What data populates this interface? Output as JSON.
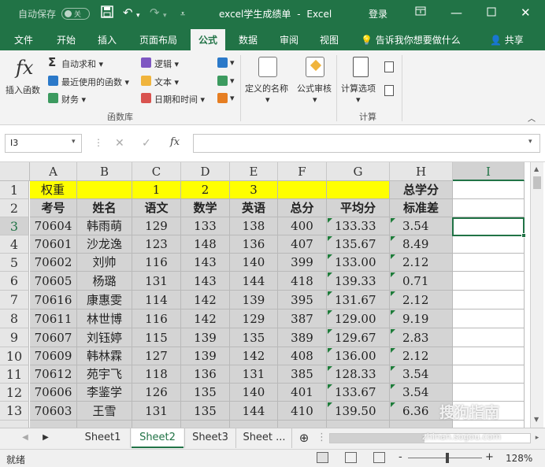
{
  "titlebar": {
    "autosave_label": "自动保存",
    "autosave_state": "关",
    "filename": "excel学生成绩单",
    "sep": "-",
    "app": "Excel",
    "login": "登录"
  },
  "tabs": [
    "文件",
    "开始",
    "插入",
    "页面布局",
    "公式",
    "数据",
    "审阅",
    "视图"
  ],
  "active_tab": "公式",
  "tell_me": "告诉我你想要做什么",
  "share": "共享",
  "ribbon": {
    "insert_function": "插入函数",
    "fx_glyph": "fx",
    "autosum": "自动求和",
    "recent": "最近使用的函数",
    "financial": "财务",
    "logical": "逻辑",
    "text": "文本",
    "datetime": "日期和时间",
    "group_library": "函数库",
    "defined_names": "定义的名称",
    "formula_audit": "公式审核",
    "calc_options": "计算选项",
    "group_calc": "计算"
  },
  "formula_bar": {
    "name_box": "I3",
    "fx": "fx",
    "value": ""
  },
  "columns": [
    "A",
    "B",
    "C",
    "D",
    "E",
    "F",
    "G",
    "H",
    "I"
  ],
  "selected_column": "I",
  "selected_row": "3",
  "rows": [
    {
      "n": "1",
      "cells": [
        "权重",
        "",
        "1",
        "2",
        "3",
        "",
        "",
        "总学分",
        ""
      ]
    },
    {
      "n": "2",
      "cells": [
        "考号",
        "姓名",
        "语文",
        "数学",
        "英语",
        "总分",
        "平均分",
        "标准差",
        ""
      ]
    },
    {
      "n": "3",
      "cells": [
        "70604",
        "韩雨萌",
        "129",
        "133",
        "138",
        "400",
        "133.33",
        "3.54",
        ""
      ]
    },
    {
      "n": "4",
      "cells": [
        "70601",
        "沙龙逸",
        "123",
        "148",
        "136",
        "407",
        "135.67",
        "8.49",
        ""
      ]
    },
    {
      "n": "5",
      "cells": [
        "70602",
        "刘帅",
        "116",
        "143",
        "140",
        "399",
        "133.00",
        "2.12",
        ""
      ]
    },
    {
      "n": "6",
      "cells": [
        "70605",
        "杨璐",
        "131",
        "143",
        "144",
        "418",
        "139.33",
        "0.71",
        ""
      ]
    },
    {
      "n": "7",
      "cells": [
        "70616",
        "康惠雯",
        "114",
        "142",
        "139",
        "395",
        "131.67",
        "2.12",
        ""
      ]
    },
    {
      "n": "8",
      "cells": [
        "70611",
        "林世博",
        "116",
        "142",
        "129",
        "387",
        "129.00",
        "9.19",
        ""
      ]
    },
    {
      "n": "9",
      "cells": [
        "70607",
        "刘钰婷",
        "115",
        "139",
        "135",
        "389",
        "129.67",
        "2.83",
        ""
      ]
    },
    {
      "n": "10",
      "cells": [
        "70609",
        "韩林霖",
        "127",
        "139",
        "142",
        "408",
        "136.00",
        "2.12",
        ""
      ]
    },
    {
      "n": "11",
      "cells": [
        "70612",
        "苑宇飞",
        "118",
        "136",
        "131",
        "385",
        "128.33",
        "3.54",
        ""
      ]
    },
    {
      "n": "12",
      "cells": [
        "70606",
        "李鉴学",
        "126",
        "135",
        "140",
        "401",
        "133.67",
        "3.54",
        ""
      ]
    },
    {
      "n": "13",
      "cells": [
        "70603",
        "王雪",
        "131",
        "135",
        "144",
        "410",
        "139.50",
        "6.36",
        ""
      ]
    }
  ],
  "colors": {
    "brand": "#217346",
    "yellow": "#ffff00",
    "gray_fill": "#d4d4d4",
    "triangle": "#1e7c3a"
  },
  "sheets": [
    "Sheet1",
    "Sheet2",
    "Sheet3",
    "Sheet ..."
  ],
  "active_sheet": "Sheet2",
  "status": {
    "ready": "就绪",
    "zoom": "128%",
    "minus": "-",
    "plus": "+"
  },
  "watermark": "搜狗指南",
  "watermark_url": "zhinan.sogou.com"
}
